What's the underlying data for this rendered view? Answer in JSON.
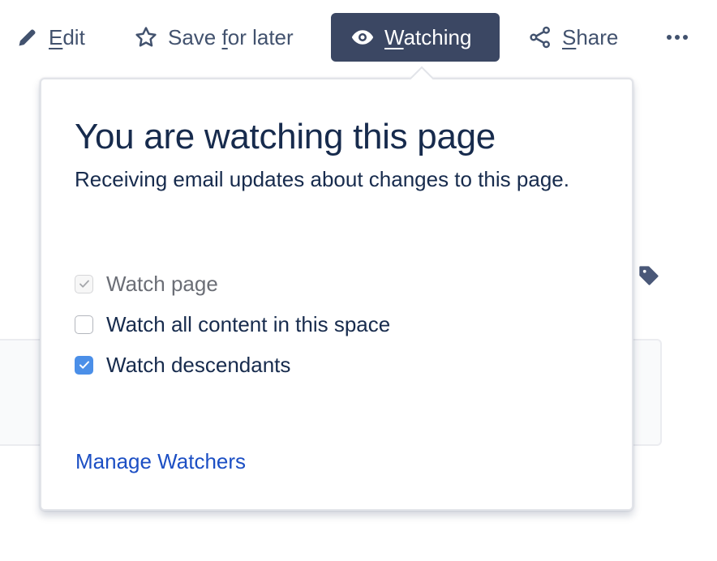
{
  "toolbar": {
    "edit": {
      "label": "Edit",
      "accesskey": "E",
      "rest": "dit",
      "icon": "pencil-icon"
    },
    "save": {
      "label": "Save for later",
      "pre": "Save ",
      "accesskey": "f",
      "rest": "or later",
      "icon": "star-icon"
    },
    "watch": {
      "label": "Watching",
      "accesskey": "W",
      "rest": "atching",
      "icon": "eye-icon",
      "active": true
    },
    "share": {
      "label": "Share",
      "accesskey": "S",
      "rest": "hare",
      "icon": "share-icon"
    },
    "more": {
      "icon": "more-icon"
    }
  },
  "popover": {
    "title": "You are watching this page",
    "description": "Receiving email updates about changes to this page.",
    "options": [
      {
        "label": "Watch page",
        "checked": true,
        "disabled": true
      },
      {
        "label": "Watch all content in this space",
        "checked": false,
        "disabled": false
      },
      {
        "label": "Watch descendants",
        "checked": true,
        "disabled": false
      }
    ],
    "link": "Manage Watchers"
  },
  "page": {
    "label_icon": "tag-icon"
  },
  "colors": {
    "active_button": "#3b4763",
    "text": "#172b4d",
    "icon": "#42526e",
    "link": "#1c4fc4",
    "checkbox_checked": "#4b8fe8"
  }
}
